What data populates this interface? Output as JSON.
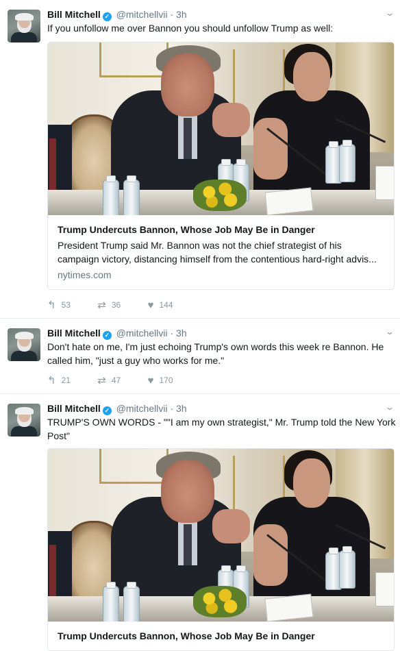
{
  "tweets": [
    {
      "name": "Bill Mitchell",
      "handle": "@mitchellvii",
      "separator": "·",
      "time": "3h",
      "text": "If you unfollow me over Bannon you should unfollow Trump as well:",
      "card": {
        "title": "Trump Undercuts Bannon, Whose Job May Be in Danger",
        "description_line1": "President Trump said Mr. Bannon was not the chief strategist of his",
        "description_line2": "campaign victory, distancing himself from the contentious hard-right advis...",
        "domain": "nytimes.com"
      },
      "reply_count": "53",
      "retweet_count": "36",
      "like_count": "144"
    },
    {
      "name": "Bill Mitchell",
      "handle": "@mitchellvii",
      "separator": "·",
      "time": "3h",
      "text": "Don't hate on me, I'm just echoing Trump's own words this week re Bannon.  He called him, \"just a guy who works for me.\"",
      "reply_count": "21",
      "retweet_count": "47",
      "like_count": "170"
    },
    {
      "name": "Bill Mitchell",
      "handle": "@mitchellvii",
      "separator": "·",
      "time": "3h",
      "text": "TRUMP'S OWN WORDS - \"\"I am my own strategist,\" Mr. Trump told the New York Post\"",
      "card": {
        "title": "Trump Undercuts Bannon, Whose Job May Be in Danger"
      }
    }
  ],
  "icons": {
    "verified": "verified-badge-icon",
    "chevron": "chevron-down-icon",
    "reply": "reply-icon",
    "retweet": "retweet-icon",
    "like": "heart-icon"
  },
  "colors": {
    "verified": "#1da1f2",
    "muted": "#657786",
    "action": "#8899a6",
    "border": "#e6ecf0"
  }
}
